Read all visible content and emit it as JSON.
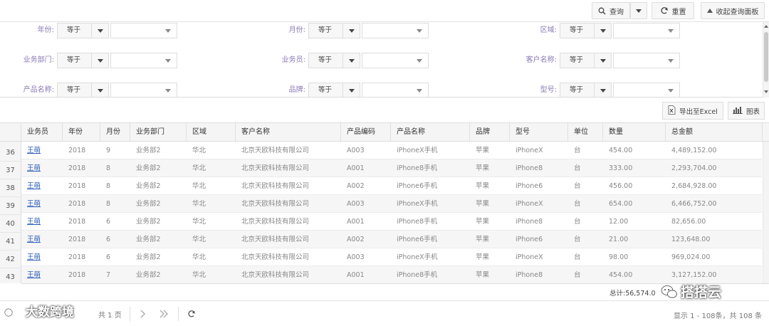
{
  "toolbar": {
    "query_label": "查询",
    "reset_label": "重置",
    "collapse_label": "收起查询面板"
  },
  "filters": [
    {
      "label": "年份:",
      "op": "等于",
      "value": ""
    },
    {
      "label": "月份:",
      "op": "等于",
      "value": ""
    },
    {
      "label": "区域:",
      "op": "等于",
      "value": ""
    },
    {
      "label": "业务部门:",
      "op": "等于",
      "value": ""
    },
    {
      "label": "业务员:",
      "op": "等于",
      "value": ""
    },
    {
      "label": "客户名称:",
      "op": "等于",
      "value": ""
    },
    {
      "label": "产品名称:",
      "op": "等于",
      "value": ""
    },
    {
      "label": "品牌:",
      "op": "等于",
      "value": ""
    },
    {
      "label": "型号:",
      "op": "等于",
      "value": ""
    }
  ],
  "actions": {
    "export_label": "导出至Excel",
    "chart_label": "图表"
  },
  "grid": {
    "columns": [
      "业务员",
      "年份",
      "月份",
      "业务部门",
      "区域",
      "客户名称",
      "产品编码",
      "产品名称",
      "品牌",
      "型号",
      "单位",
      "数量",
      "总金额"
    ],
    "row_numbers": [
      "36",
      "37",
      "38",
      "39",
      "40",
      "41",
      "42",
      "43"
    ],
    "rows": [
      [
        "王萌",
        "2018",
        "9",
        "业务部2",
        "华北",
        "北京天欧科技有限公司",
        "A003",
        "iPhoneX手机",
        "苹果",
        "iPhoneX",
        "台",
        "454.00",
        "4,489,152.00"
      ],
      [
        "王萌",
        "2018",
        "8",
        "业务部2",
        "华北",
        "北京天欧科技有限公司",
        "A001",
        "iPhone8手机",
        "苹果",
        "iPhone8",
        "台",
        "333.00",
        "2,293,704.00"
      ],
      [
        "王萌",
        "2018",
        "8",
        "业务部2",
        "华北",
        "北京天欧科技有限公司",
        "A002",
        "iPhone6手机",
        "苹果",
        "iPhone6",
        "台",
        "456.00",
        "2,684,928.00"
      ],
      [
        "王萌",
        "2018",
        "8",
        "业务部2",
        "华北",
        "北京天欧科技有限公司",
        "A003",
        "iPhoneX手机",
        "苹果",
        "iPhoneX",
        "台",
        "654.00",
        "6,466,752.00"
      ],
      [
        "王萌",
        "2018",
        "6",
        "业务部2",
        "华北",
        "北京天欧科技有限公司",
        "A001",
        "iPhone8手机",
        "苹果",
        "iPhone8",
        "台",
        "12.00",
        "82,656.00"
      ],
      [
        "王萌",
        "2018",
        "6",
        "业务部2",
        "华北",
        "北京天欧科技有限公司",
        "A002",
        "iPhone6手机",
        "苹果",
        "iPhone6",
        "台",
        "21.00",
        "123,648.00"
      ],
      [
        "王萌",
        "2018",
        "6",
        "业务部2",
        "华北",
        "北京天欧科技有限公司",
        "A003",
        "iPhoneX手机",
        "苹果",
        "iPhoneX",
        "台",
        "98.00",
        "969,024.00"
      ],
      [
        "王萌",
        "2018",
        "7",
        "业务部2",
        "华北",
        "北京天欧科技有限公司",
        "A001",
        "iPhone8手机",
        "苹果",
        "iPhone8",
        "台",
        "454.00",
        "3,127,152.00"
      ]
    ],
    "total_label": "总计:56,574.0"
  },
  "pager": {
    "page_text": "共 1 页",
    "info": "显示 1 - 108条，共 108 条"
  },
  "watermarks": {
    "left": "大数跨境",
    "right": "搭搭云"
  }
}
